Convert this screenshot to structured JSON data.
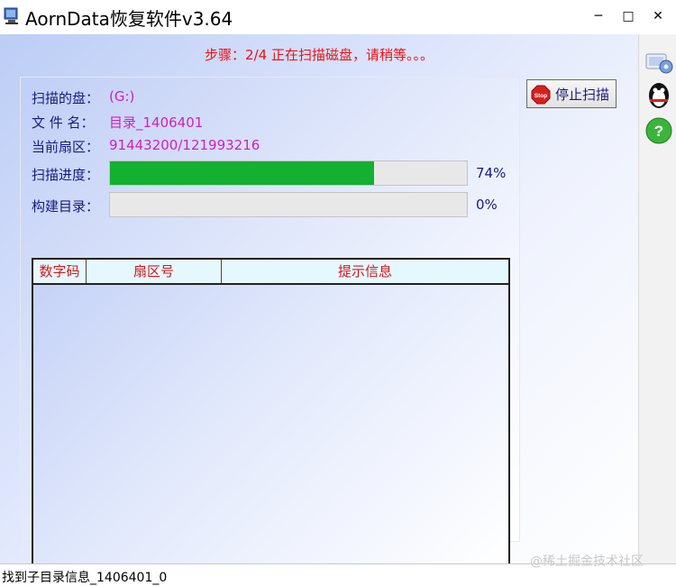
{
  "window": {
    "title": "AornData恢复软件v3.64",
    "controls": {
      "minimize": "─",
      "maximize": "□",
      "close": "✕"
    }
  },
  "step_text": "步骤：2/4 正在扫描磁盘，请稍等。。。",
  "scan_info": {
    "disk_label": "扫描的盘：",
    "disk_value": "(G:)",
    "file_label": "文 件 名：",
    "file_value": "目录_1406401",
    "sector_label": "当前扇区：",
    "sector_value": "91443200/121993216",
    "progress_label": "扫描进度：",
    "progress_percent": 74,
    "progress_text": "74%",
    "build_label": "构建目录：",
    "build_percent": 0,
    "build_text": "0%"
  },
  "table": {
    "columns": [
      "数字码",
      "扇区号",
      "提示信息"
    ],
    "rows": []
  },
  "stop_button": {
    "label": "停止扫描",
    "icon": "stop-icon",
    "icon_text": "Stop"
  },
  "side_icons": [
    "settings-icon",
    "qq-penguin-icon",
    "help-icon"
  ],
  "status_text": "找到子目录信息_1406401_0",
  "watermark": "@稀土掘金技术社区",
  "colors": {
    "accent_green": "#14b030",
    "step_red": "#ee1111",
    "value_magenta": "#d020c0",
    "label_navy": "#1a1a80"
  }
}
